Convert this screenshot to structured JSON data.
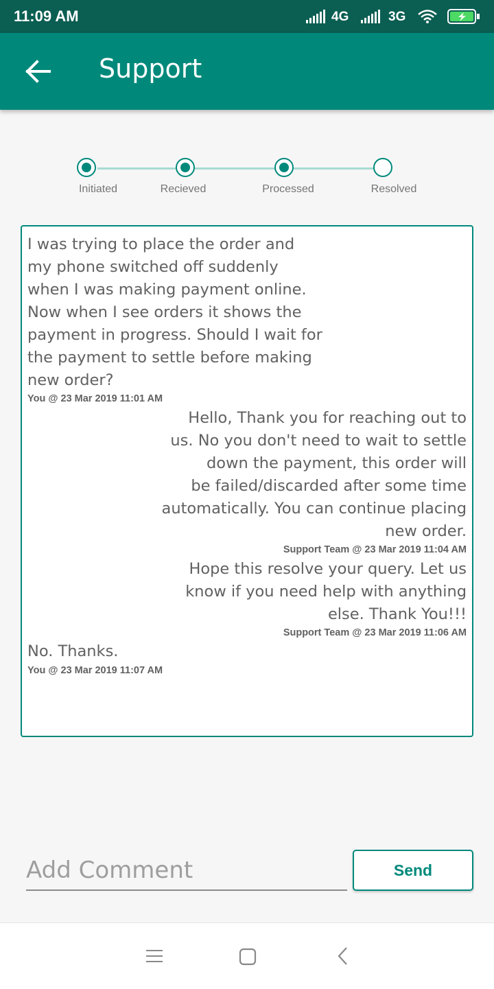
{
  "status_bar": {
    "time": "11:09 AM",
    "network1": "4G",
    "network2": "3G"
  },
  "header": {
    "title": "Support"
  },
  "stepper": {
    "steps": [
      {
        "label": "Initiated",
        "done": true
      },
      {
        "label": "Recieved",
        "done": true
      },
      {
        "label": "Processed",
        "done": true
      },
      {
        "label": "Resolved",
        "done": false
      }
    ]
  },
  "messages": [
    {
      "text": "I was trying to place the order and\nmy phone switched off suddenly\nwhen I was making payment online.\nNow when I see orders it shows the\npayment in progress. Should I wait for\nthe payment to settle before making\nnew order?",
      "meta": "You @ 23 Mar 2019 11:01 AM",
      "align": "left"
    },
    {
      "text": "Hello, Thank you for reaching out to\nus. No you don't need to wait to settle\ndown the payment,  this order will\nbe failed/discarded after some time\nautomatically. You can continue placing\nnew order.",
      "meta": "Support Team @ 23 Mar 2019 11:04 AM",
      "align": "right"
    },
    {
      "text": "Hope this resolve your query. Let us\nknow if you need help with anything\nelse. Thank You!!!",
      "meta": "Support Team @ 23 Mar 2019 11:06 AM",
      "align": "right"
    },
    {
      "text": "No. Thanks.",
      "meta": "You @ 23 Mar 2019 11:07 AM",
      "align": "left"
    }
  ],
  "comment": {
    "placeholder": "Add Comment",
    "send_label": "Send"
  },
  "colors": {
    "primary": "#00897b",
    "status_bar": "#0b5e52",
    "stepper_line": "#a7dbd2"
  },
  "icons": {
    "back": "arrow-left-icon",
    "menu": "menu-icon",
    "home": "home-icon",
    "nav_back": "chevron-left-icon"
  }
}
